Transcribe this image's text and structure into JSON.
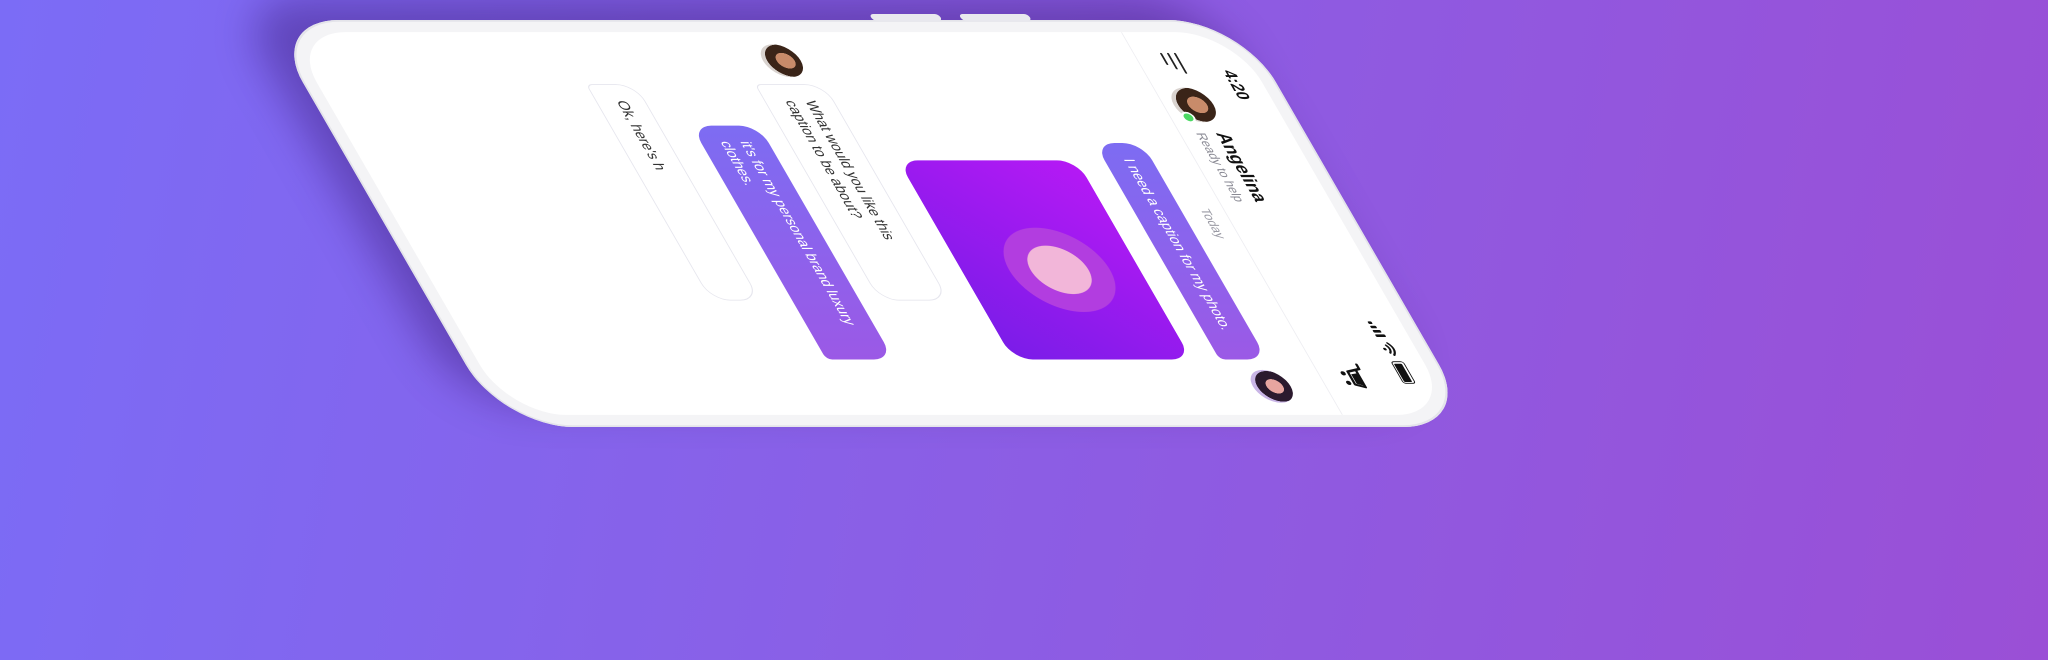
{
  "status_bar": {
    "time": "4:20"
  },
  "header": {
    "contact_name": "Angelina",
    "contact_status": "Ready to help"
  },
  "chat": {
    "day_label": "Today",
    "messages": [
      {
        "from": "user",
        "text": "I need a caption for my photo."
      },
      {
        "from": "bot",
        "text": "What would you like this caption to be about?"
      },
      {
        "from": "user",
        "text": "it's for my personal brand luxury clothes."
      },
      {
        "from": "bot",
        "text": "Ok, here's h"
      }
    ]
  },
  "colors": {
    "background_start": "#7b6cf6",
    "background_end": "#9a4fd6",
    "bubble_out_start": "#7d6cf2",
    "bubble_out_end": "#9b59e6",
    "online": "#4cd964",
    "photo": "#b619f5"
  },
  "icons": [
    "menu-icon",
    "cart-icon",
    "signal-icon",
    "wifi-icon",
    "battery-icon"
  ]
}
